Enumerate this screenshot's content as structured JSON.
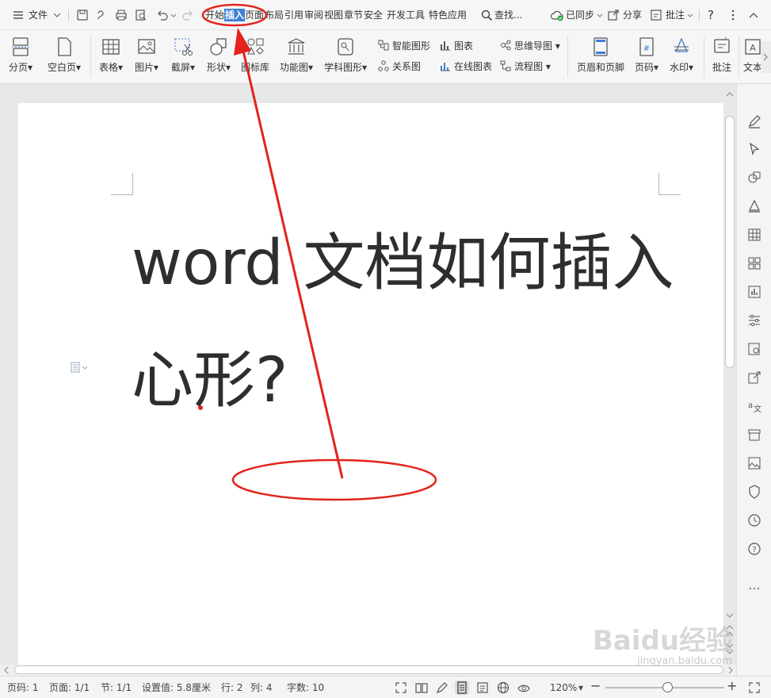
{
  "menubar": {
    "file_label": "文件",
    "tabs": [
      "开始",
      "插入",
      "页面",
      "布局",
      "引用",
      "审阅",
      "视图",
      "章节",
      "安全",
      "开发工具",
      "特色应用"
    ],
    "active_tab": "插入",
    "search_label": "查找...",
    "sync_label": "已同步",
    "share_label": "分享",
    "comment_label": "批注",
    "help_label": "?"
  },
  "ribbon": {
    "big": [
      "分页",
      "空白页",
      "表格",
      "图片",
      "截屏",
      "形状",
      "图标库",
      "功能图",
      "学科图形",
      "页眉和页脚",
      "页码",
      "水印",
      "批注",
      "文本框"
    ],
    "small": [
      "智能图形",
      "关系图",
      "图表",
      "在线图表",
      "思维导图",
      "流程图"
    ]
  },
  "document": {
    "title_line1": "word 文档如何插入",
    "title_line2": "心形?"
  },
  "statusbar": {
    "page_num": "页码: 1",
    "pages": "页面: 1/1",
    "section": "节: 1/1",
    "setting": "设置值: 5.8厘米",
    "row": "行: 2",
    "col": "列: 4",
    "wordcount": "字数: 10",
    "zoom": "120%"
  },
  "watermark": {
    "brand": "Baidu经验",
    "site": "jingyan.baidu.com"
  },
  "colors": {
    "accent": "#3f7fd6",
    "annotation": "#e3231c"
  }
}
